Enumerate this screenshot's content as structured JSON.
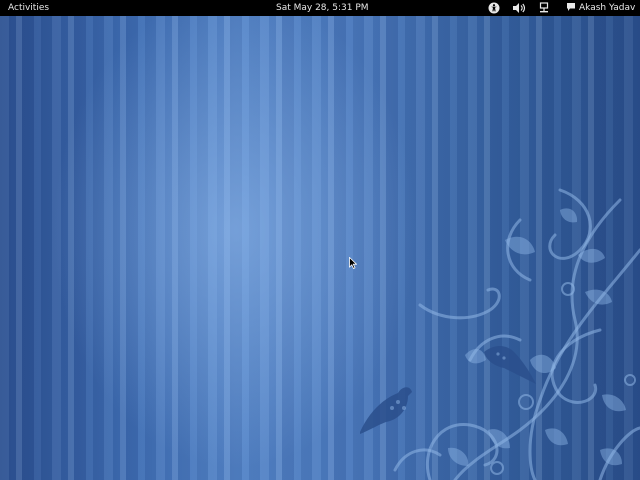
{
  "topbar": {
    "activities_label": "Activities",
    "clock": "Sat May 28,  5:31 PM",
    "user_name": "Akash Yadav",
    "icons": {
      "accessibility": "accessibility-icon",
      "volume": "volume-icon",
      "network": "network-icon",
      "chat": "chat-icon"
    }
  },
  "desktop": {
    "wallpaper_theme": "blue-striped-floral-birds",
    "colors": {
      "base": "#3e6db3",
      "highlight": "#7aa6e0",
      "art": "#8fb6e6",
      "topbar": "#000000"
    }
  }
}
